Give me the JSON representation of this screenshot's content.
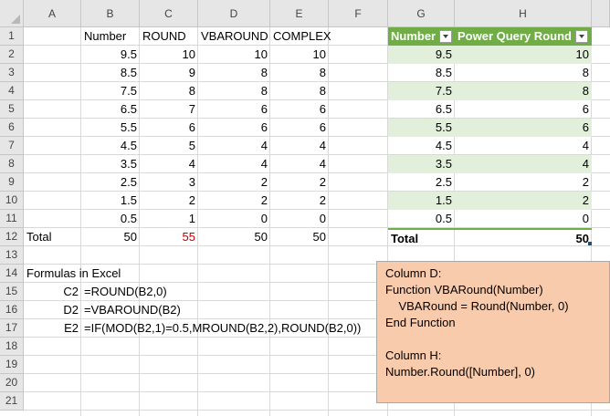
{
  "columns": [
    "A",
    "B",
    "C",
    "D",
    "E",
    "F",
    "G",
    "H"
  ],
  "rows": [
    "1",
    "2",
    "3",
    "4",
    "5",
    "6",
    "7",
    "8",
    "9",
    "10",
    "11",
    "12",
    "13",
    "14",
    "15",
    "16",
    "17",
    "18",
    "19",
    "20",
    "21"
  ],
  "headers": {
    "number": "Number",
    "round": "ROUND",
    "vbaround": "VBAROUND",
    "complex": "COMPLEX"
  },
  "data": [
    [
      "9.5",
      "10",
      "10",
      "10"
    ],
    [
      "8.5",
      "9",
      "8",
      "8"
    ],
    [
      "7.5",
      "8",
      "8",
      "8"
    ],
    [
      "6.5",
      "7",
      "6",
      "6"
    ],
    [
      "5.5",
      "6",
      "6",
      "6"
    ],
    [
      "4.5",
      "5",
      "4",
      "4"
    ],
    [
      "3.5",
      "4",
      "4",
      "4"
    ],
    [
      "2.5",
      "3",
      "2",
      "2"
    ],
    [
      "1.5",
      "2",
      "2",
      "2"
    ],
    [
      "0.5",
      "1",
      "0",
      "0"
    ]
  ],
  "total": {
    "label": "Total",
    "b": "50",
    "c": "55",
    "d": "50",
    "e": "50"
  },
  "pq_table": {
    "header_number": "Number",
    "header_round": "Power Query Round",
    "rows": [
      [
        "9.5",
        "10"
      ],
      [
        "8.5",
        "8"
      ],
      [
        "7.5",
        "8"
      ],
      [
        "6.5",
        "6"
      ],
      [
        "5.5",
        "6"
      ],
      [
        "4.5",
        "4"
      ],
      [
        "3.5",
        "4"
      ],
      [
        "2.5",
        "2"
      ],
      [
        "1.5",
        "2"
      ],
      [
        "0.5",
        "0"
      ]
    ],
    "total_label": "Total",
    "total_value": "50",
    "header_color": "#70ad47",
    "band_color": "#e2efda"
  },
  "formulas": {
    "title": "Formulas in Excel",
    "items": [
      {
        "ref": "C2",
        "formula": "=ROUND(B2,0)"
      },
      {
        "ref": "D2",
        "formula": "=VBAROUND(B2)"
      },
      {
        "ref": "E2",
        "formula": "=IF(MOD(B2,1)=0.5,MROUND(B2,2),ROUND(B2,0))"
      }
    ]
  },
  "note": {
    "lines": [
      "Column D:",
      "Function VBARound(Number)",
      "    VBARound = Round(Number, 0)",
      "End Function",
      "",
      "Column H:",
      "Number.Round([Number], 0)"
    ],
    "color": "#f8cbad"
  },
  "highlight_color": "#c00000"
}
